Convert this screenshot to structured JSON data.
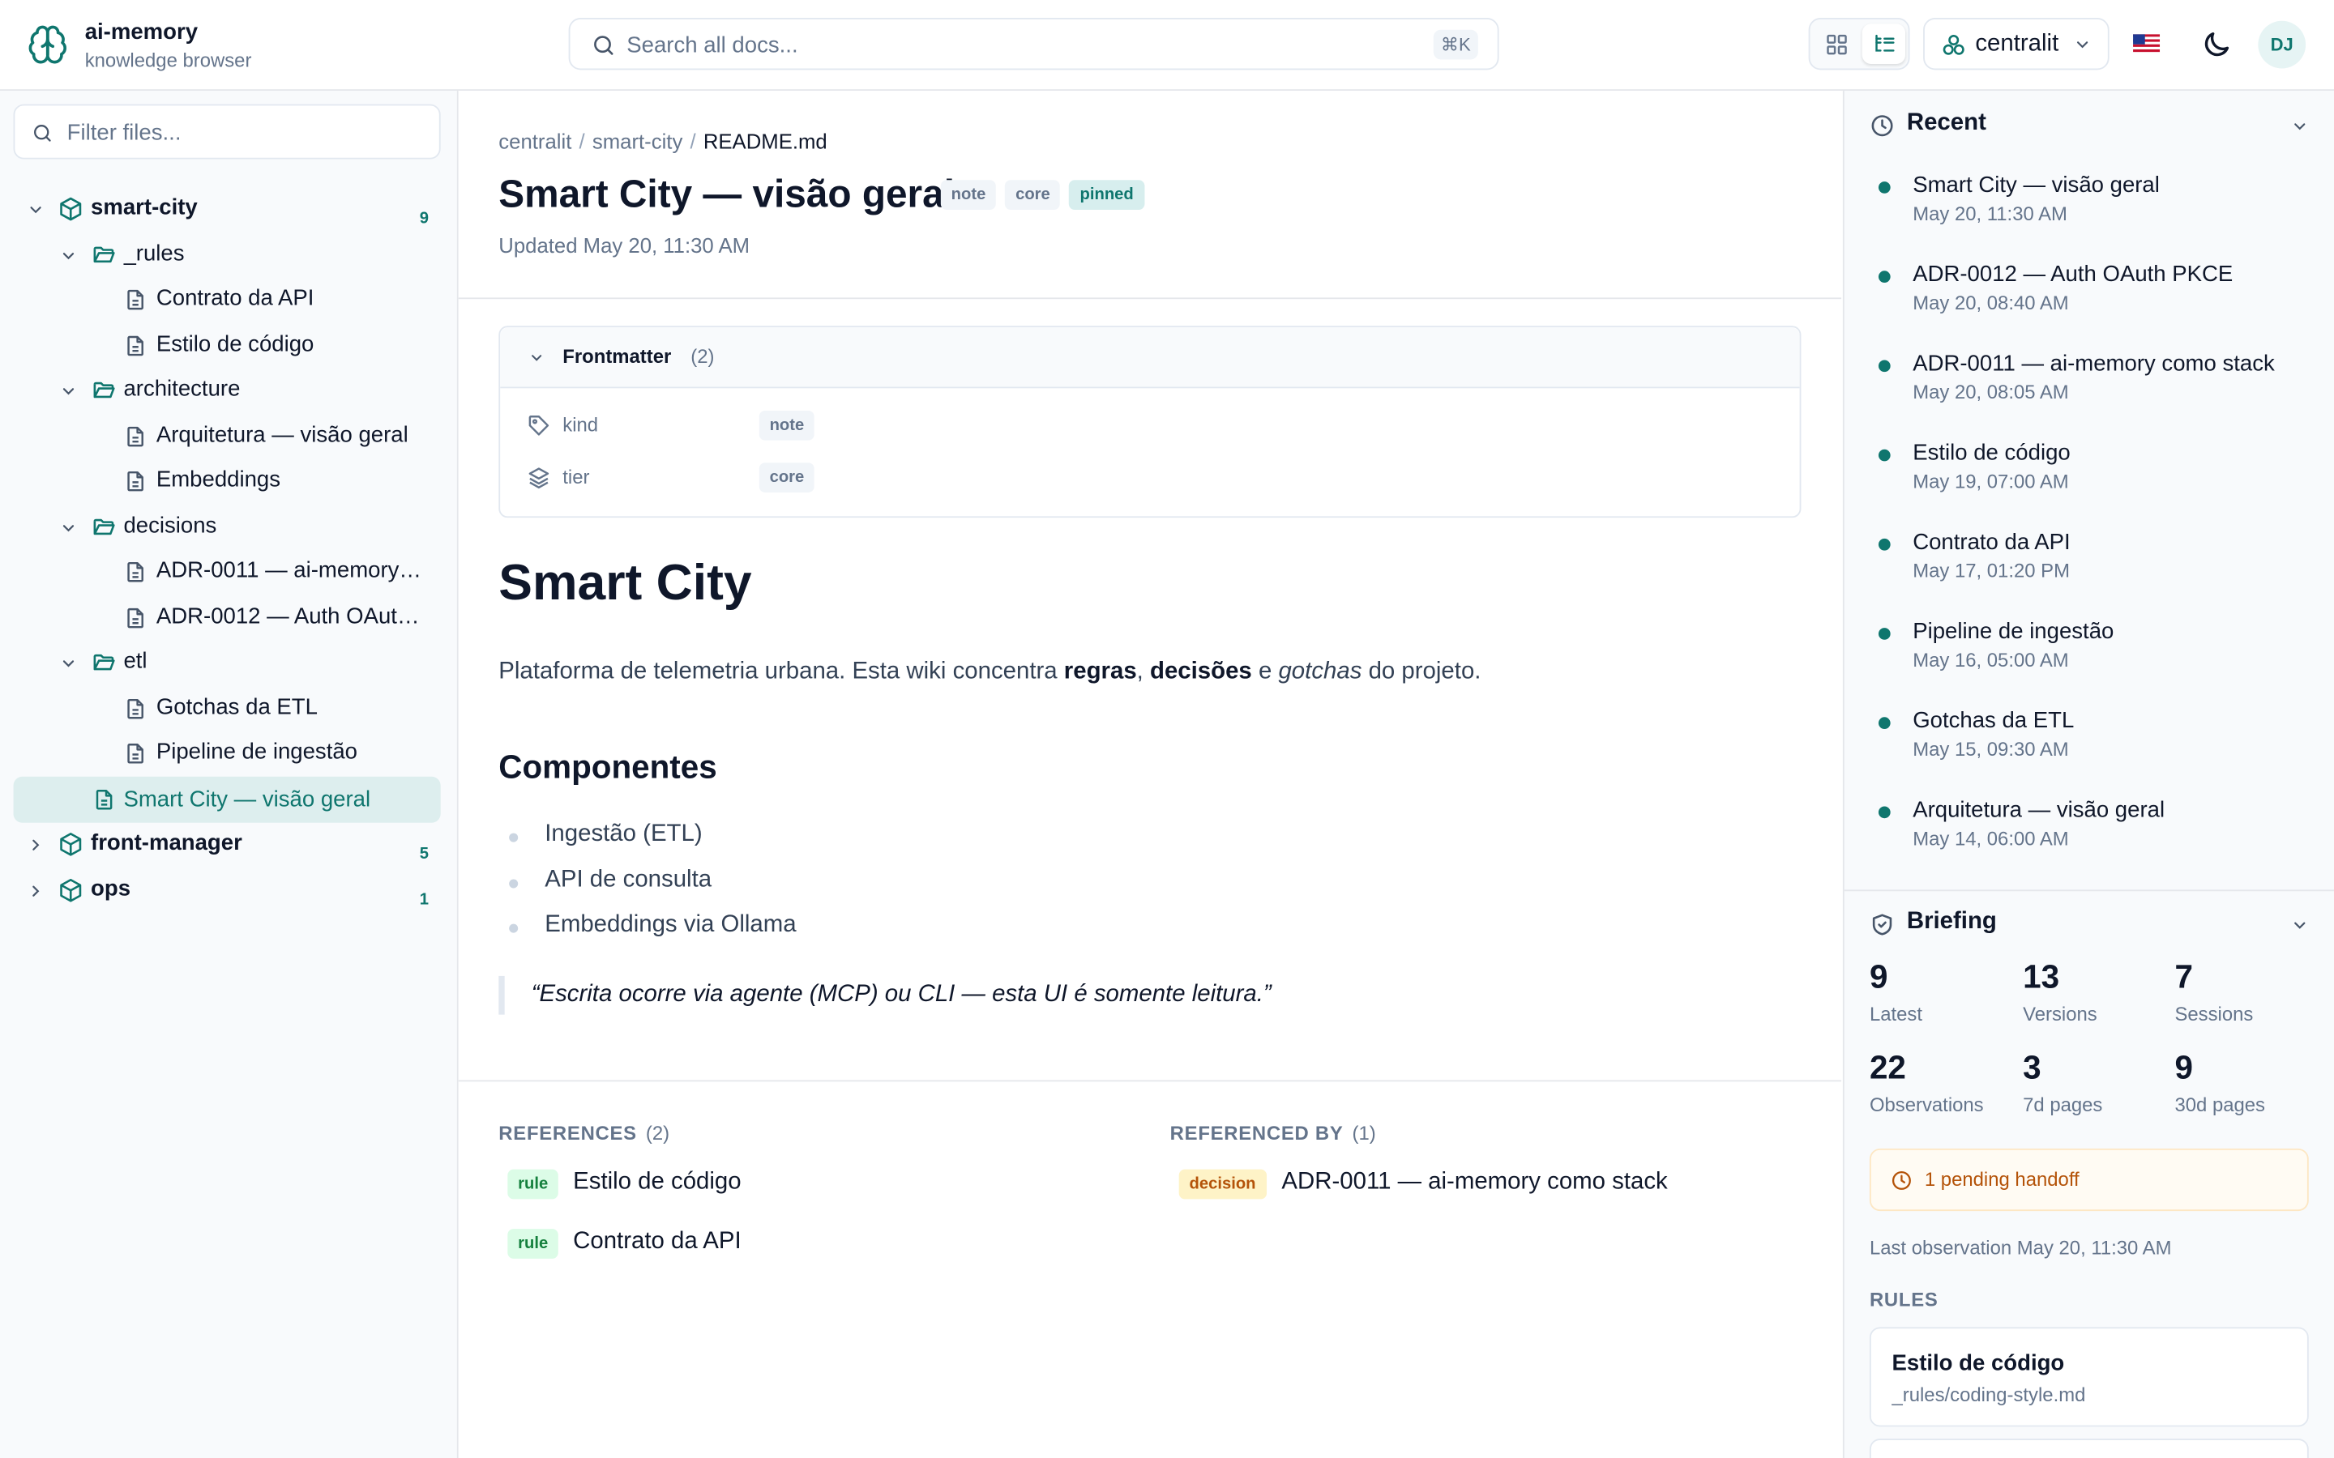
{
  "app": {
    "name": "ai-memory",
    "subtitle": "knowledge browser"
  },
  "search": {
    "placeholder": "Search all docs...",
    "shortcut": "⌘K"
  },
  "view_modes": [
    "grid-icon",
    "tree-icon"
  ],
  "project_selector": {
    "value": "centralit"
  },
  "locale_flag": "us-flag",
  "user": {
    "initials": "DJ"
  },
  "sidebar": {
    "filter_placeholder": "Filter files...",
    "projects": [
      {
        "name": "smart-city",
        "count": "9",
        "expanded": true
      },
      {
        "name": "front-manager",
        "count": "5",
        "expanded": false
      },
      {
        "name": "ops",
        "count": "1",
        "expanded": false
      }
    ],
    "folders": {
      "rules": {
        "name": "_rules",
        "files": [
          "Contrato da API",
          "Estilo de código"
        ]
      },
      "architecture": {
        "name": "architecture",
        "files": [
          "Arquitetura — visão geral",
          "Embeddings"
        ]
      },
      "decisions": {
        "name": "decisions",
        "files": [
          "ADR-0011 — ai-memory…",
          "ADR-0012 — Auth OAut…"
        ]
      },
      "etl": {
        "name": "etl",
        "files": [
          "Gotchas da ETL",
          "Pipeline de ingestão"
        ]
      }
    },
    "active_file": "Smart City — visão geral"
  },
  "doc": {
    "breadcrumb": [
      "centralit",
      "smart-city",
      "README.md"
    ],
    "breadcrumb_sep": "/",
    "title": "Smart City — visão geral",
    "tags": [
      "note",
      "core",
      "pinned"
    ],
    "updated": "Updated May 20, 11:30 AM",
    "frontmatter": {
      "label": "Frontmatter",
      "count": "(2)",
      "rows": [
        {
          "key": "kind",
          "value": "note"
        },
        {
          "key": "tier",
          "value": "core"
        }
      ]
    },
    "h1": "Smart City",
    "intro": {
      "p1": "Plataforma de telemetria urbana. Esta wiki concentra ",
      "b1": "regras",
      "p2": ", ",
      "b2": "decisões",
      "p3": " e ",
      "i1": "gotchas",
      "p4": " do projeto."
    },
    "h2": "Componentes",
    "components": [
      "Ingestão (ETL)",
      "API de consulta",
      "Embeddings via Ollama"
    ],
    "quote": "“Escrita ocorre via agente (MCP) ou CLI — esta UI é somente leitura.”",
    "references": {
      "label": "REFERENCES",
      "count": "(2)",
      "items": [
        {
          "tag": "rule",
          "title": "Estilo de código"
        },
        {
          "tag": "rule",
          "title": "Contrato da API"
        }
      ]
    },
    "referenced_by": {
      "label": "REFERENCED BY",
      "count": "(1)",
      "items": [
        {
          "tag": "decision",
          "title": "ADR-0011 — ai-memory como stack"
        }
      ]
    }
  },
  "recent": {
    "title": "Recent",
    "items": [
      {
        "title": "Smart City — visão geral",
        "date": "May 20, 11:30 AM"
      },
      {
        "title": "ADR-0012 — Auth OAuth PKCE",
        "date": "May 20, 08:40 AM"
      },
      {
        "title": "ADR-0011 — ai-memory como stack",
        "date": "May 20, 08:05 AM"
      },
      {
        "title": "Estilo de código",
        "date": "May 19, 07:00 AM"
      },
      {
        "title": "Contrato da API",
        "date": "May 17, 01:20 PM"
      },
      {
        "title": "Pipeline de ingestão",
        "date": "May 16, 05:00 AM"
      },
      {
        "title": "Gotchas da ETL",
        "date": "May 15, 09:30 AM"
      },
      {
        "title": "Arquitetura — visão geral",
        "date": "May 14, 06:00 AM"
      }
    ]
  },
  "briefing": {
    "title": "Briefing",
    "stats": [
      {
        "value": "9",
        "label": "Latest"
      },
      {
        "value": "13",
        "label": "Versions"
      },
      {
        "value": "7",
        "label": "Sessions"
      },
      {
        "value": "22",
        "label": "Observations"
      },
      {
        "value": "3",
        "label": "7d pages"
      },
      {
        "value": "9",
        "label": "30d pages"
      }
    ],
    "handoff": "1 pending handoff",
    "last_observation": "Last observation May 20, 11:30 AM",
    "rules_label": "RULES",
    "rules": [
      {
        "title": "Estilo de código",
        "path": "_rules/coding-style.md"
      }
    ]
  },
  "colors": {
    "accent": "#0f766e",
    "accent_bg": "#ddeeee",
    "handoff": "#b45309"
  }
}
